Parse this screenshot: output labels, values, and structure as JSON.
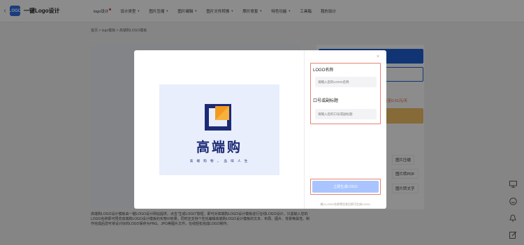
{
  "site": {
    "logo_icon_text": "LOGO",
    "name": "一键Logo设计",
    "back_icon": "chevron-left-icon"
  },
  "nav": [
    {
      "label": "logo设计",
      "caret": false,
      "dot": true
    },
    {
      "label": "设计类型",
      "caret": true
    },
    {
      "label": "图片压缩",
      "caret": true
    },
    {
      "label": "图片编辑",
      "caret": true
    },
    {
      "label": "图片文件转换",
      "caret": true
    },
    {
      "label": "照片修复",
      "caret": true
    },
    {
      "label": "特色功能",
      "caret": true
    },
    {
      "label": "工具箱",
      "caret": false
    },
    {
      "label": "我的设计",
      "caret": false
    }
  ],
  "breadcrumb": "首页 > logo模板 > 高端购LOGO模板",
  "background_panel": {
    "price": "低至0.01元/天",
    "tools": [
      "图片压缩",
      "图片转PDF",
      "图片转文字"
    ]
  },
  "description": "高端购LOGO设计模板由一键LOGO设计网站提供，点击“生成LOGO”按钮，即可对高端购LOGO设计模板进行在线LOGO设计，只需输入您的LOGO名称即可预览高端购LOGO设计模板的实物VI效果，同时还支持个性化编辑高端购LOGO设计模板的文本、布局、图片、背景等属性。制作完成后您可将设计好的LOGO保存为PNG、JPG等图片文件，在线轻松完成LOGO制作。",
  "modal": {
    "close_label": "×",
    "logo_preview": {
      "brand": "高端购",
      "slogan": "高 端 购 物 ， 品 味 人 生"
    },
    "form": {
      "name_label": "LOGO名称",
      "name_placeholder": "请输入您的LOGO名称",
      "slogan_label": "口号或副标题",
      "slogan_placeholder": "请输入您的口号或副标题"
    },
    "generate_label": "立即生成LOGO",
    "footnote": "输入LOGO名称等信息后即可生成LOGO"
  },
  "side_icons": [
    "monitor-icon",
    "smile-icon",
    "bell-icon",
    "edit-icon"
  ],
  "colors": {
    "primary": "#1f5fd6",
    "accent_border": "#e88272",
    "generate_button": "#a9c4ff",
    "logo_navy": "#1c2a74",
    "logo_orange": "#f39a1e"
  }
}
